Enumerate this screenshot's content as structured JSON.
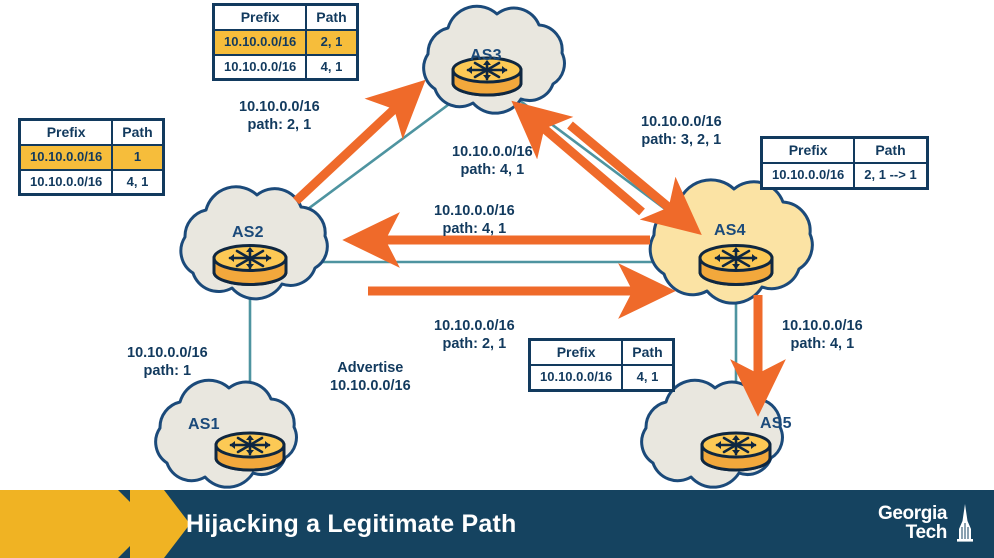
{
  "slide": {
    "title": "Hijacking a Legitimate Path",
    "brand": {
      "line1": "Georgia",
      "line2": "Tech",
      "logo_icon": "georgia-tech-tower-icon"
    },
    "colors": {
      "banner_bg": "#154360",
      "banner_accent": "#f0b323",
      "navy": "#123a5e",
      "cloud_outline": "#1b4a7a",
      "cloud_fill": "#e9e7df",
      "cloud_fill_highlight": "#fbe3a4",
      "router_fill": "#f9c149",
      "router_dark": "#0f2740",
      "link_line": "#4e94a0",
      "arrow_orange": "#ef6a2a",
      "row_highlight": "#f6bd3b"
    }
  },
  "nodes": [
    {
      "id": "as1",
      "label": "AS1"
    },
    {
      "id": "as2",
      "label": "AS2"
    },
    {
      "id": "as3",
      "label": "AS3"
    },
    {
      "id": "as4",
      "label": "AS4"
    },
    {
      "id": "as5",
      "label": "AS5"
    }
  ],
  "tables": {
    "as3": {
      "name": "as3-routing-table",
      "headers": [
        "Prefix",
        "Path"
      ],
      "rows": [
        {
          "prefix": "10.10.0.0/16",
          "path": "2, 1",
          "highlight": true
        },
        {
          "prefix": "10.10.0.0/16",
          "path": "4, 1",
          "highlight": false
        }
      ]
    },
    "as2": {
      "name": "as2-routing-table",
      "headers": [
        "Prefix",
        "Path"
      ],
      "rows": [
        {
          "prefix": "10.10.0.0/16",
          "path": "1",
          "highlight": true
        },
        {
          "prefix": "10.10.0.0/16",
          "path": "4, 1",
          "highlight": false
        }
      ]
    },
    "as4_right": {
      "name": "as4-right-routing-table",
      "headers": [
        "Prefix",
        "Path"
      ],
      "rows": [
        {
          "prefix": "10.10.0.0/16",
          "path": "2, 1 --> 1",
          "highlight": false
        }
      ]
    },
    "as4_bottom": {
      "name": "as4-bottom-routing-table",
      "headers": [
        "Prefix",
        "Path"
      ],
      "rows": [
        {
          "prefix": "10.10.0.0/16",
          "path": "4, 1",
          "highlight": false
        }
      ]
    }
  },
  "annotations": {
    "a": {
      "prefix": "10.10.0.0/16",
      "path": "path: 2, 1"
    },
    "b": {
      "prefix": "10.10.0.0/16",
      "path": "path: 4, 1"
    },
    "c": {
      "prefix": "10.10.0.0/16",
      "path": "path: 3, 2, 1"
    },
    "d": {
      "prefix": "10.10.0.0/16",
      "path": "path: 4, 1"
    },
    "e": {
      "prefix": "10.10.0.0/16",
      "path": "path: 2, 1"
    },
    "f": {
      "prefix": "10.10.0.0/16",
      "path": "path: 1"
    },
    "g": {
      "line1": "Advertise",
      "line2": "10.10.0.0/16"
    },
    "h": {
      "prefix": "10.10.0.0/16",
      "path": "path: 4, 1"
    }
  }
}
